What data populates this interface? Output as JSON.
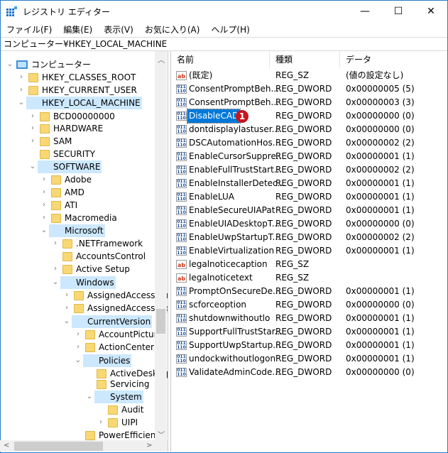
{
  "window": {
    "title": "レジストリ エディター",
    "minimize": "—",
    "maximize": "☐",
    "close": "✕"
  },
  "menu": [
    "ファイル(F)",
    "編集(E)",
    "表示(V)",
    "お気に入り(A)",
    "ヘルプ(H)"
  ],
  "address": "コンピューター¥HKEY_LOCAL_MACHINE",
  "tree": [
    {
      "label": "コンピューター",
      "level": 0,
      "exp": "open",
      "computer": true
    },
    {
      "label": "HKEY_CLASSES_ROOT",
      "level": 1,
      "exp": "closed"
    },
    {
      "label": "HKEY_CURRENT_USER",
      "level": 1,
      "exp": "closed"
    },
    {
      "label": "HKEY_LOCAL_MACHINE",
      "level": 1,
      "exp": "open",
      "sel": true
    },
    {
      "label": "BCD00000000",
      "level": 2,
      "exp": "closed"
    },
    {
      "label": "HARDWARE",
      "level": 2,
      "exp": "closed"
    },
    {
      "label": "SAM",
      "level": 2,
      "exp": "closed"
    },
    {
      "label": "SECURITY",
      "level": 2,
      "exp": "none"
    },
    {
      "label": "SOFTWARE",
      "level": 2,
      "exp": "open",
      "sel": true
    },
    {
      "label": "Adobe",
      "level": 3,
      "exp": "closed"
    },
    {
      "label": "AMD",
      "level": 3,
      "exp": "closed"
    },
    {
      "label": "ATI",
      "level": 3,
      "exp": "closed"
    },
    {
      "label": "Macromedia",
      "level": 3,
      "exp": "closed"
    },
    {
      "label": "Microsoft",
      "level": 3,
      "exp": "open",
      "sel": true
    },
    {
      "label": ".NETFramework",
      "level": 4,
      "exp": "closed"
    },
    {
      "label": "AccountsControl",
      "level": 4,
      "exp": "none"
    },
    {
      "label": "Active Setup",
      "level": 4,
      "exp": "closed"
    },
    {
      "label": "ADs",
      "level": 4,
      "exp": "closed"
    },
    {
      "label": "Windows",
      "level": 4,
      "exp": "open",
      "sel": true
    },
    {
      "label": "AssignedAccessConfiguration",
      "level": 5,
      "exp": "closed"
    },
    {
      "label": "AssignedAccessCsp",
      "level": 5,
      "exp": "closed"
    },
    {
      "label": "CurrentVersion",
      "level": 5,
      "exp": "open",
      "sel": true
    },
    {
      "label": "AccountPicture",
      "level": 6,
      "exp": "closed"
    },
    {
      "label": "ActionCenter",
      "level": 6,
      "exp": "closed"
    },
    {
      "label": "Policies",
      "level": 6,
      "exp": "open",
      "sel": true
    },
    {
      "label": "ActiveDesktop",
      "level": 7,
      "exp": "none"
    },
    {
      "label": "Servicing",
      "level": 7,
      "exp": "none"
    },
    {
      "label": "System",
      "level": 7,
      "exp": "open",
      "sel": true
    },
    {
      "label": "Audit",
      "level": 8,
      "exp": "none"
    },
    {
      "label": "UIPI",
      "level": 8,
      "exp": "closed"
    },
    {
      "label": "PowerEfficiency",
      "level": 6,
      "exp": "none"
    }
  ],
  "columns": {
    "name": "名前",
    "type": "種類",
    "data": "データ"
  },
  "values": [
    {
      "name": "(既定)",
      "type": "REG_SZ",
      "data": "(値の設定なし)",
      "kind": "sz"
    },
    {
      "name": "ConsentPromptBeh...",
      "type": "REG_DWORD",
      "data": "0x00000005 (5)",
      "kind": "dw"
    },
    {
      "name": "ConsentPromptBeh...",
      "type": "REG_DWORD",
      "data": "0x00000003 (3)",
      "kind": "dw"
    },
    {
      "name": "DisableCAD",
      "type": "REG_DWORD",
      "data": "0x00000000 (0)",
      "kind": "dw",
      "sel": true,
      "badge": "1"
    },
    {
      "name": "dontdisplaylastuser...",
      "type": "REG_DWORD",
      "data": "0x00000000 (0)",
      "kind": "dw"
    },
    {
      "name": "DSCAutomationHos...",
      "type": "REG_DWORD",
      "data": "0x00000002 (2)",
      "kind": "dw"
    },
    {
      "name": "EnableCursorSuppre...",
      "type": "REG_DWORD",
      "data": "0x00000001 (1)",
      "kind": "dw"
    },
    {
      "name": "EnableFullTrustStart...",
      "type": "REG_DWORD",
      "data": "0x00000002 (2)",
      "kind": "dw"
    },
    {
      "name": "EnableInstallerDetec...",
      "type": "REG_DWORD",
      "data": "0x00000001 (1)",
      "kind": "dw"
    },
    {
      "name": "EnableLUA",
      "type": "REG_DWORD",
      "data": "0x00000001 (1)",
      "kind": "dw"
    },
    {
      "name": "EnableSecureUIAPat",
      "type": "REG_DWORD",
      "data": "0x00000001 (1)",
      "kind": "dw"
    },
    {
      "name": "EnableUIADesktopT...",
      "type": "REG_DWORD",
      "data": "0x00000000 (0)",
      "kind": "dw"
    },
    {
      "name": "EnableUwpStartupT...",
      "type": "REG_DWORD",
      "data": "0x00000002 (2)",
      "kind": "dw"
    },
    {
      "name": "EnableVirtualization",
      "type": "REG_DWORD",
      "data": "0x00000001 (1)",
      "kind": "dw"
    },
    {
      "name": "legalnoticecaption",
      "type": "REG_SZ",
      "data": "",
      "kind": "sz"
    },
    {
      "name": "legalnoticetext",
      "type": "REG_SZ",
      "data": "",
      "kind": "sz"
    },
    {
      "name": "PromptOnSecureDe...",
      "type": "REG_DWORD",
      "data": "0x00000001 (1)",
      "kind": "dw"
    },
    {
      "name": "scforceoption",
      "type": "REG_DWORD",
      "data": "0x00000000 (0)",
      "kind": "dw"
    },
    {
      "name": "shutdownwithoutlo",
      "type": "REG_DWORD",
      "data": "0x00000001 (1)",
      "kind": "dw"
    },
    {
      "name": "SupportFullTrustStar...",
      "type": "REG_DWORD",
      "data": "0x00000001 (1)",
      "kind": "dw"
    },
    {
      "name": "SupportUwpStartup...",
      "type": "REG_DWORD",
      "data": "0x00000001 (1)",
      "kind": "dw"
    },
    {
      "name": "undockwithoutlogon",
      "type": "REG_DWORD",
      "data": "0x00000001 (1)",
      "kind": "dw"
    },
    {
      "name": "ValidateAdminCode...",
      "type": "REG_DWORD",
      "data": "0x00000000 (0)",
      "kind": "dw"
    }
  ],
  "icons": {
    "sz": "ab",
    "dw": "011\n110"
  }
}
